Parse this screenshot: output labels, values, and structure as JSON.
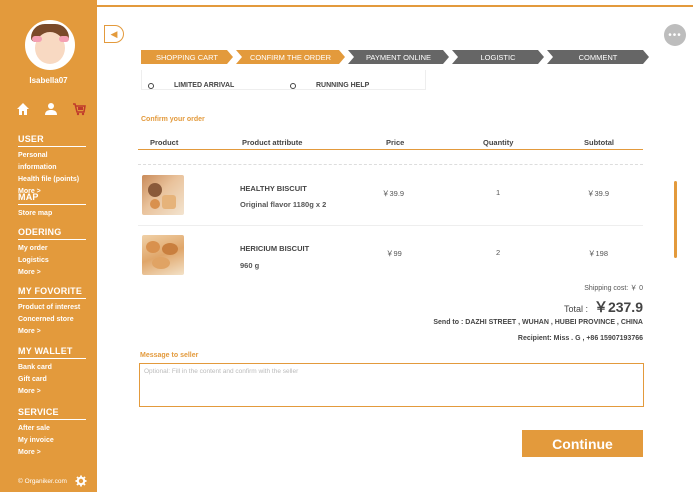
{
  "user": {
    "name": "Isabella07"
  },
  "sidebar": {
    "sections": [
      {
        "title": "USER",
        "items": [
          "Personal information",
          "Health file (points)",
          "More >"
        ]
      },
      {
        "title": "MAP",
        "items": [
          "Store map"
        ]
      },
      {
        "title": "ODERING",
        "items": [
          "My order",
          "Logistics",
          "More >"
        ]
      },
      {
        "title": "MY FOVORITE",
        "items": [
          "Product of interest",
          "Concerned store",
          "More >"
        ]
      },
      {
        "title": "MY WALLET",
        "items": [
          "Bank card",
          "Gift card",
          "More >"
        ]
      },
      {
        "title": "SERVICE",
        "items": [
          "After sale",
          "My invoice",
          "More >"
        ]
      }
    ],
    "footer": "© Organiker.com"
  },
  "steps": [
    {
      "label": "SHOPPING CART",
      "state": "active"
    },
    {
      "label": "CONFIRM THE ORDER",
      "state": "active"
    },
    {
      "label": "PAYMENT ONLINE",
      "state": "inactive"
    },
    {
      "label": "LOGISTIC",
      "state": "inactive"
    },
    {
      "label": "COMMENT",
      "state": "inactive"
    }
  ],
  "delivery_options": [
    "LIMITED ARRIVAL",
    "RUNNING HELP"
  ],
  "confirm_label": "Confirm your order",
  "table": {
    "headers": [
      "Product",
      "Product attribute",
      "Price",
      "Quantity",
      "Subtotal"
    ],
    "rows": [
      {
        "name": "HEALTHY  BISCUIT",
        "attribute": "Original flavor 1180g x 2",
        "price": "￥39.9",
        "quantity": "1",
        "subtotal": "￥39.9"
      },
      {
        "name": "HERICIUM BISCUIT",
        "attribute": "960 g",
        "price": "￥99",
        "quantity": "2",
        "subtotal": "￥198"
      }
    ]
  },
  "summary": {
    "shipping": "Shipping cost: ￥ 0",
    "total_label": "Total :",
    "total_value": "￥237.9",
    "send_to": "Send to :  DAZHI STREET , WUHAN , HUBEI PROVINCE , CHINA",
    "recipient": "Recipient:  Miss . G , +86 15907193766"
  },
  "message": {
    "label": "Message to seller",
    "placeholder": "Optional: Fill in the content and confirm with the seller"
  },
  "continue_label": "Continue",
  "colors": {
    "accent": "#e39a3c",
    "step_inactive": "#666666"
  },
  "icons": [
    "home-icon",
    "user-icon",
    "cart-icon",
    "gear-icon",
    "back-arrow-icon",
    "more-icon"
  ]
}
